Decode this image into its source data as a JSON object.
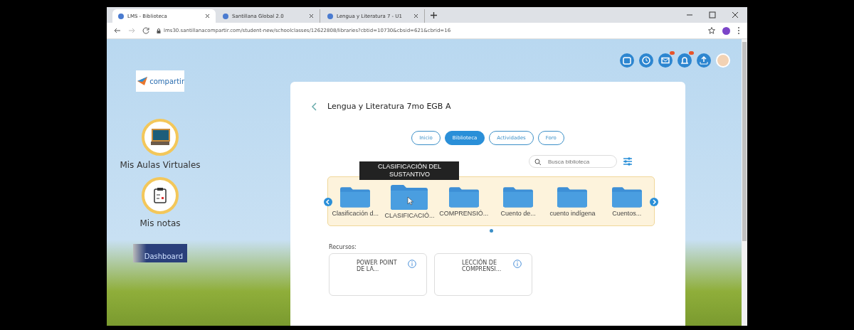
{
  "browser": {
    "tabs": [
      {
        "title": "LMS - Biblioteca",
        "selected": true
      },
      {
        "title": "Santillana Global 2.0",
        "selected": false
      },
      {
        "title": "Lengua y Literatura 7 - U1",
        "selected": false
      }
    ],
    "url": "lms30.santillanacompartir.com/student-new/schoolclasses/12622808/libraries?cbtid=10730&cbsid=621&cbrid=16"
  },
  "sidebar": {
    "logo": "compartir",
    "items": [
      {
        "label": "Mis Aulas Virtuales",
        "kind": "classroom"
      },
      {
        "label": "Mis notas",
        "kind": "notes"
      }
    ],
    "dashboard": "Dashboard"
  },
  "header_icons": [
    {
      "kind": "calendar",
      "badge": false
    },
    {
      "kind": "clock",
      "badge": false
    },
    {
      "kind": "mail",
      "badge": true
    },
    {
      "kind": "bell",
      "badge": true
    },
    {
      "kind": "upload",
      "badge": false
    }
  ],
  "course": {
    "title": "Lengua y Literatura 7mo EGB A",
    "tabs": [
      {
        "label": "Inicio",
        "selected": false
      },
      {
        "label": "Biblioteca",
        "selected": true
      },
      {
        "label": "Actividades",
        "selected": false
      },
      {
        "label": "Foro",
        "selected": false
      }
    ],
    "search": {
      "placeholder": "Busca biblioteca"
    },
    "tooltip": "CLASIFICACIÓN DEL SUSTANTIVO",
    "folders": [
      {
        "name": "Clasificación d...",
        "hovered": false
      },
      {
        "name": "CLASIFICACIÓ...",
        "hovered": true
      },
      {
        "name": "COMPRENSIÓ...",
        "hovered": false
      },
      {
        "name": "Cuento de...",
        "hovered": false
      },
      {
        "name": "cuento indígena",
        "hovered": false
      },
      {
        "name": "Cuentos...",
        "hovered": false
      }
    ],
    "pages": [
      {
        "selected": true
      }
    ],
    "resources_label": "Recursos:",
    "resources": [
      {
        "title": "POWER POINT DE LA..."
      },
      {
        "title": "LECCIÓN DE COMPRENSI..."
      }
    ]
  }
}
